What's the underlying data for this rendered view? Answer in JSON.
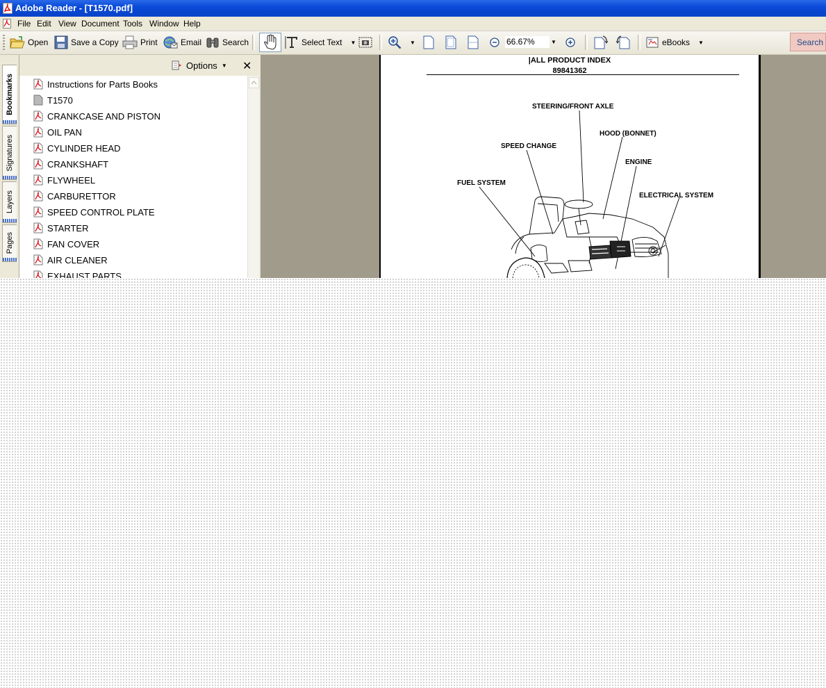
{
  "window": {
    "title": "Adobe Reader - [T1570.pdf]"
  },
  "menu": [
    "File",
    "Edit",
    "View",
    "Document",
    "Tools",
    "Window",
    "Help"
  ],
  "toolbar": {
    "open": "Open",
    "save_copy": "Save a Copy",
    "print": "Print",
    "email": "Email",
    "search": "Search",
    "select_text": "Select Text",
    "zoom": "66.67%",
    "ebooks": "eBooks",
    "search_box": "Search"
  },
  "sidetabs": [
    "Bookmarks",
    "Signatures",
    "Layers",
    "Pages"
  ],
  "panel": {
    "options": "Options",
    "bookmarks": [
      "Instructions for Parts Books",
      "T1570",
      "CRANKCASE AND PISTON",
      "OIL PAN",
      "CYLINDER HEAD",
      "CRANKSHAFT",
      "FLYWHEEL",
      "CARBURETTOR",
      "SPEED CONTROL PLATE",
      "STARTER",
      "FAN COVER",
      "AIR CLEANER",
      "EXHAUST PARTS"
    ]
  },
  "document": {
    "title": "|ALL PRODUCT INDEX",
    "number": "89841362",
    "callouts": {
      "steering": "STEERING/FRONT AXLE",
      "hood": "HOOD (BONNET)",
      "speed_change": "SPEED CHANGE",
      "engine": "ENGINE",
      "fuel": "FUEL SYSTEM",
      "electrical": "ELECTRICAL SYSTEM"
    }
  }
}
